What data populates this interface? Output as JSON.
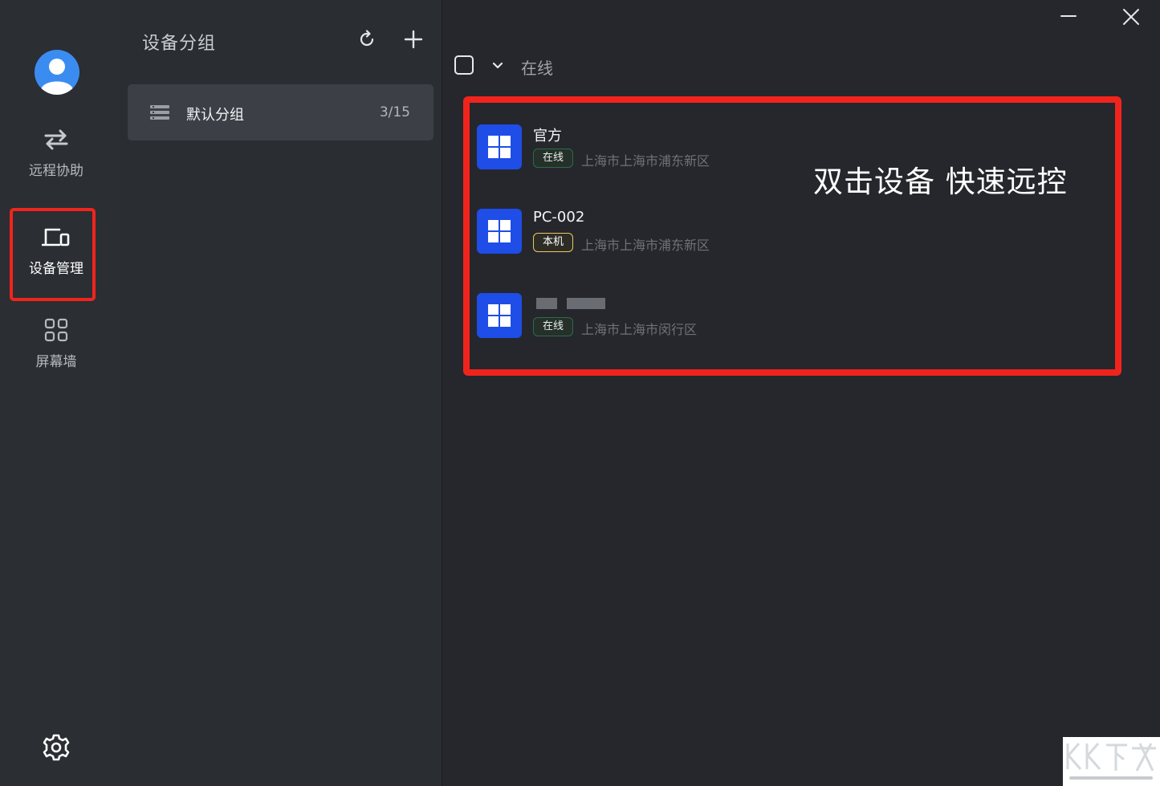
{
  "nav": {
    "items": [
      {
        "label": "远程协助",
        "icon": "arrows-swap-icon"
      },
      {
        "label": "设备管理",
        "icon": "devices-icon",
        "active": true
      },
      {
        "label": "屏幕墙",
        "icon": "grid-icon"
      }
    ],
    "settings_icon": "gear-icon"
  },
  "groups": {
    "title": "设备分组",
    "list": [
      {
        "name": "默认分组",
        "count": "3/15"
      }
    ]
  },
  "main": {
    "filter_label": "在线",
    "hint": "双击设备 快速远控",
    "devices": [
      {
        "name": "官方",
        "badge": "在线",
        "location": "上海市上海市浦东新区",
        "os_icon": "windows-icon"
      },
      {
        "name": "PC-002",
        "badge": "本机",
        "location": "上海市上海市浦东新区",
        "os_icon": "windows-icon"
      },
      {
        "name": "",
        "badge": "在线",
        "location": "上海市上海市闵行区",
        "os_icon": "windows-icon"
      }
    ]
  },
  "colors": {
    "accent_red": "#f0241c",
    "windows_blue": "#1f4de8",
    "avatar_blue": "#3b8cf1",
    "online_border": "#2e6b47",
    "local_border": "#e9c865"
  }
}
